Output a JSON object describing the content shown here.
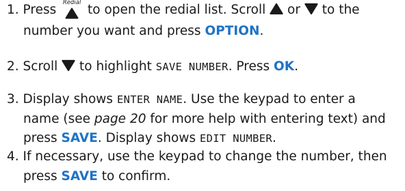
{
  "steps": [
    {
      "number": "1.",
      "line1_a": "Press",
      "redial_label": "Redial",
      "line1_b": "to open the redial list. Scroll",
      "line1_c": "or",
      "line1_d": "to the",
      "line2_a": "number you want and press",
      "line2_key": "OPTION",
      "line2_end": "."
    },
    {
      "number": "2.",
      "line1_a": "Scroll",
      "line1_b": "to highlight",
      "line1_display": "SAVE NUMBER",
      "line1_c": ". Press",
      "line1_key": "OK",
      "line1_end": "."
    },
    {
      "number": "3.",
      "line1_a": "Display shows",
      "line1_display": "ENTER NAME",
      "line1_b": ". Use the keypad to enter a",
      "line2_a": "name (see",
      "line2_ref": "page 20",
      "line2_b": "for more help with entering text) and",
      "line3_a": "press",
      "line3_key": "SAVE",
      "line3_b": ". Display shows",
      "line3_display": "EDIT NUMBER",
      "line3_end": "."
    },
    {
      "number": "4.",
      "line1": "If necessary, use the keypad to change the number, then",
      "line2_a": "press",
      "line2_key": "SAVE",
      "line2_b": "to confirm."
    }
  ],
  "icons": {
    "up": "up-triangle-icon",
    "down": "down-triangle-icon",
    "redial": "redial-up-key-icon"
  },
  "colors": {
    "key_highlight": "#1f73c4",
    "text": "#1a1a1a"
  }
}
